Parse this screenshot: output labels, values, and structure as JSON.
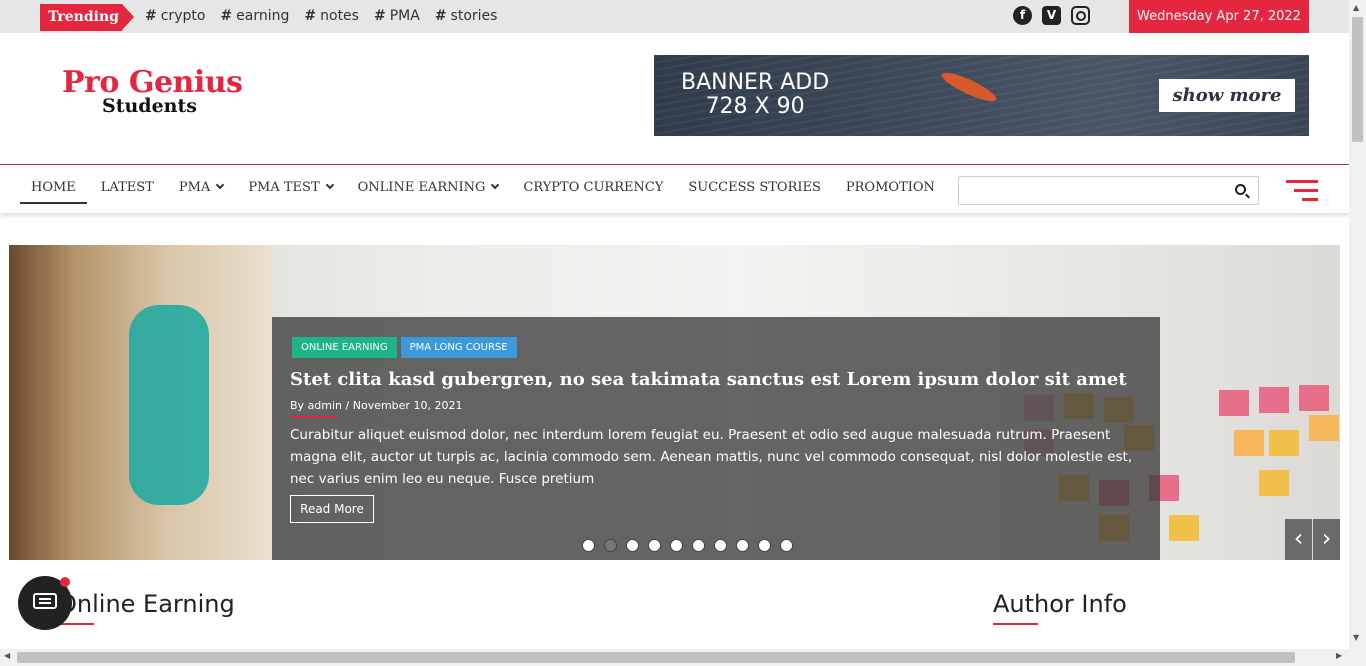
{
  "topbar": {
    "trending_label": "Trending",
    "tags": [
      "crypto",
      "earning",
      "notes",
      "PMA",
      "stories"
    ],
    "social_icons": [
      "facebook-icon",
      "vimeo-icon",
      "instagram-icon"
    ],
    "date": "Wednesday Apr 27, 2022"
  },
  "header": {
    "logo_line1": "Pro Genius",
    "logo_line2": "Students",
    "banner_line1": "BANNER ADD",
    "banner_line2": "728 X 90",
    "banner_button": "show more"
  },
  "nav": {
    "items": [
      {
        "label": "HOME",
        "dropdown": false
      },
      {
        "label": "LATEST",
        "dropdown": false
      },
      {
        "label": "PMA",
        "dropdown": true
      },
      {
        "label": "PMA TEST",
        "dropdown": true
      },
      {
        "label": "ONLINE EARNING",
        "dropdown": true
      },
      {
        "label": "CRYPTO CURRENCY",
        "dropdown": false
      },
      {
        "label": "SUCCESS STORIES",
        "dropdown": false
      },
      {
        "label": "PROMOTION",
        "dropdown": false
      }
    ],
    "search_placeholder": ""
  },
  "slider": {
    "categories": [
      "ONLINE EARNING",
      "PMA LONG COURSE"
    ],
    "title": "Stet clita kasd gubergren, no sea takimata sanctus est Lorem ipsum dolor sit amet",
    "meta_by": "By",
    "author": "admin",
    "date": "November 10, 2021",
    "excerpt": "Curabitur aliquet euismod dolor, nec interdum lorem feugiat eu. Praesent et odio sed augue malesuada rutrum. Praesent magna elit, auctor ut turpis ac, lacinia commodo sem. Aenean mattis, nunc vel commodo consequat, nisl dolor molestie est, nec varius enim leo eu neque. Fusce pretium",
    "read_more": "Read More",
    "dot_count": 10,
    "active_dot": 1,
    "prev_arrow": "‹",
    "next_arrow": "›"
  },
  "sections": {
    "left_title": "Online Earning",
    "right_title": "Author Info"
  },
  "colors": {
    "accent": "#e5263f",
    "green_badge": "#1db587",
    "blue_badge": "#3b9ad9"
  }
}
